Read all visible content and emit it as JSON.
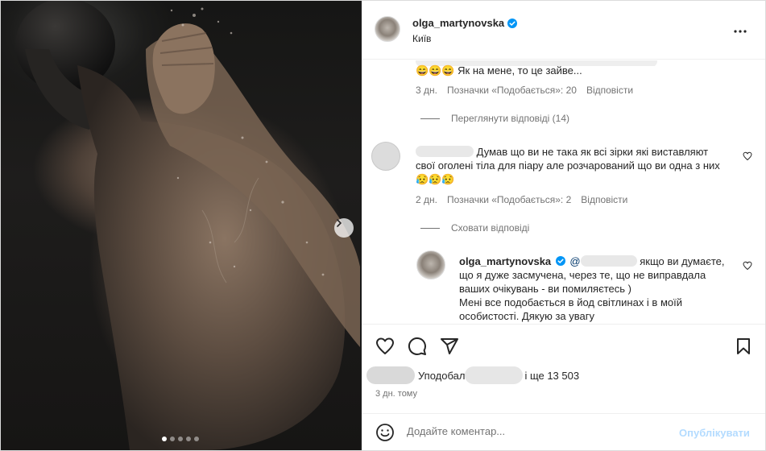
{
  "colors": {
    "accent": "#0095f6",
    "verified": "#0095f6",
    "muted": "#737373",
    "publish_disabled": "#b3dbff"
  },
  "post": {
    "author": "olga_martynovska",
    "location": "Київ"
  },
  "comments": {
    "c0_text": "😄😄😄 Як на мене, то це зайве...",
    "c0_time": "3 дн.",
    "c0_likes": "Позначки «Подобається»: 20",
    "c0_reply": "Відповісти",
    "view_replies": "Переглянути відповіді (14)",
    "c1_text": "Думав що ви не така як всі зірки які виставляют свої оголені тіла для піару але розчарований що ви одна з них 😥😥😥",
    "c1_time": "2 дн.",
    "c1_likes": "Позначки «Подобається»: 2",
    "c1_reply": "Відповісти",
    "hide_replies": "Сховати відповіді",
    "r1_author": "olga_martynovska",
    "r1_mention": "@",
    "r1_text_a": " якщо ви думаєте, що я дуже засмучена, через те, що не виправдала ваших очікувань - ви помиляєтесь )",
    "r1_text_b": "Мені все подобається в йод світлинах і в моїй особистості. Дякую за увагу"
  },
  "likes": {
    "prefix": "Уподобал",
    "suffix": "і ще 13 503"
  },
  "time_ago": "3 дн. тому",
  "comment_box": {
    "placeholder": "Додайте коментар...",
    "publish_label": "Опублікувати"
  },
  "carousel": {
    "total": 5,
    "active_index": 0
  },
  "icons": [
    "verified-badge-icon",
    "more-options-icon",
    "heart-icon",
    "comment-icon",
    "share-icon",
    "bookmark-icon",
    "emoji-icon",
    "chevron-right-icon"
  ]
}
